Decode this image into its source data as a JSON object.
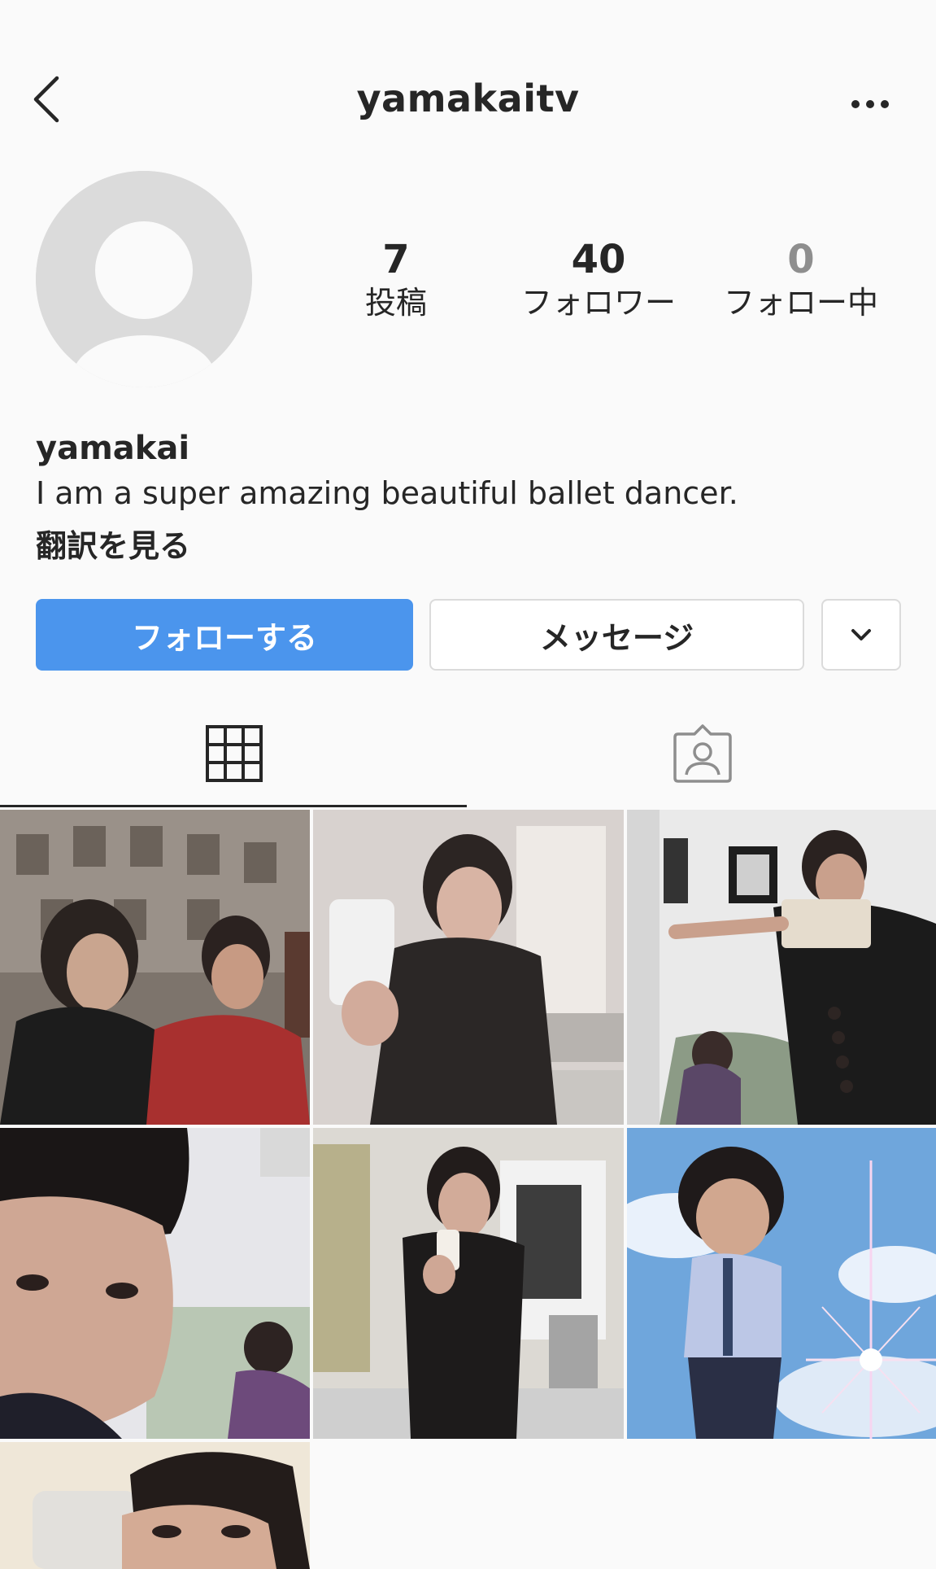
{
  "header": {
    "username": "yamakaitv",
    "back_icon": "chevron-left-icon",
    "more_icon": "more-horizontal-icon"
  },
  "profile": {
    "avatar_icon": "default-avatar-icon",
    "stats": [
      {
        "value": "7",
        "label": "投稿"
      },
      {
        "value": "40",
        "label": "フォロワー"
      },
      {
        "value": "0",
        "label": "フォロー中"
      }
    ],
    "display_name": "yamakai",
    "bio": "I am a super amazing beautiful ballet dancer.",
    "translate_link": "翻訳を見る"
  },
  "actions": {
    "follow_label": "フォローする",
    "message_label": "メッセージ",
    "more_icon": "chevron-down-icon"
  },
  "tabs": {
    "grid_icon": "grid-icon",
    "tagged_icon": "tagged-user-icon",
    "active": "grid"
  },
  "colors": {
    "accent": "#4b95ed",
    "background": "#fafafa",
    "border": "#dbdbdb",
    "text": "#262626",
    "muted": "#8e8e8e"
  },
  "posts": [
    {
      "id": 1,
      "scene": "two people on city street"
    },
    {
      "id": 2,
      "scene": "mirror selfie in black shirt"
    },
    {
      "id": 3,
      "scene": "man filming with phone rig"
    },
    {
      "id": 4,
      "scene": "close-up selfie face"
    },
    {
      "id": 5,
      "scene": "bathroom mirror selfie"
    },
    {
      "id": 6,
      "scene": "anime sky composite"
    },
    {
      "id": 7,
      "scene": "close-up face partial"
    }
  ]
}
